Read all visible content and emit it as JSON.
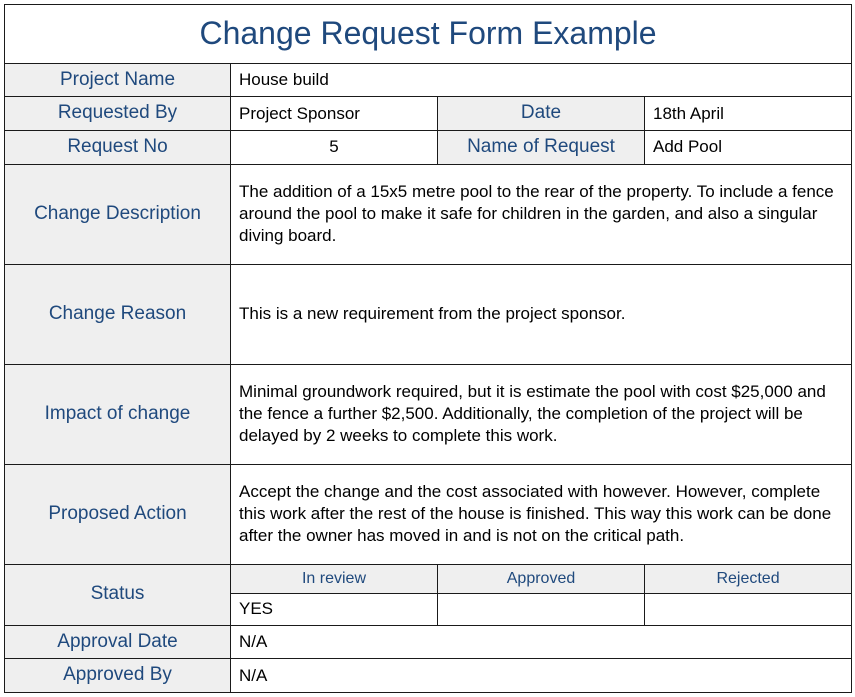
{
  "title": "Change Request Form Example",
  "fields": {
    "project_name_label": "Project Name",
    "project_name_value": "House build",
    "requested_by_label": "Requested By",
    "requested_by_value": "Project Sponsor",
    "date_label": "Date",
    "date_value": "18th April",
    "request_no_label": "Request No",
    "request_no_value": "5",
    "name_of_request_label": "Name of Request",
    "name_of_request_value": "Add Pool",
    "change_description_label": "Change Description",
    "change_description_value": "The addition of a 15x5 metre pool to the rear of the property. To include a fence around the pool to make it safe for children in the garden, and also a singular diving board.",
    "change_reason_label": "Change Reason",
    "change_reason_value": "This is a new requirement from the project sponsor.",
    "impact_label": "Impact of change",
    "impact_value": "Minimal groundwork required, but it is estimate the pool with cost $25,000 and the fence a further $2,500. Additionally, the completion of the project will be delayed by 2 weeks to complete this work.",
    "proposed_action_label": "Proposed Action",
    "proposed_action_value": "Accept the change and the cost associated with however. However, complete this work after the rest of the house is finished. This way this work can be done after the owner has moved in and is not on the critical path.",
    "status_label": "Status",
    "status_headers": {
      "in_review": "In review",
      "approved": "Approved",
      "rejected": "Rejected"
    },
    "status_values": {
      "in_review": "YES",
      "approved": "",
      "rejected": ""
    },
    "approval_date_label": "Approval Date",
    "approval_date_value": "N/A",
    "approved_by_label": "Approved By",
    "approved_by_value": "N/A"
  }
}
